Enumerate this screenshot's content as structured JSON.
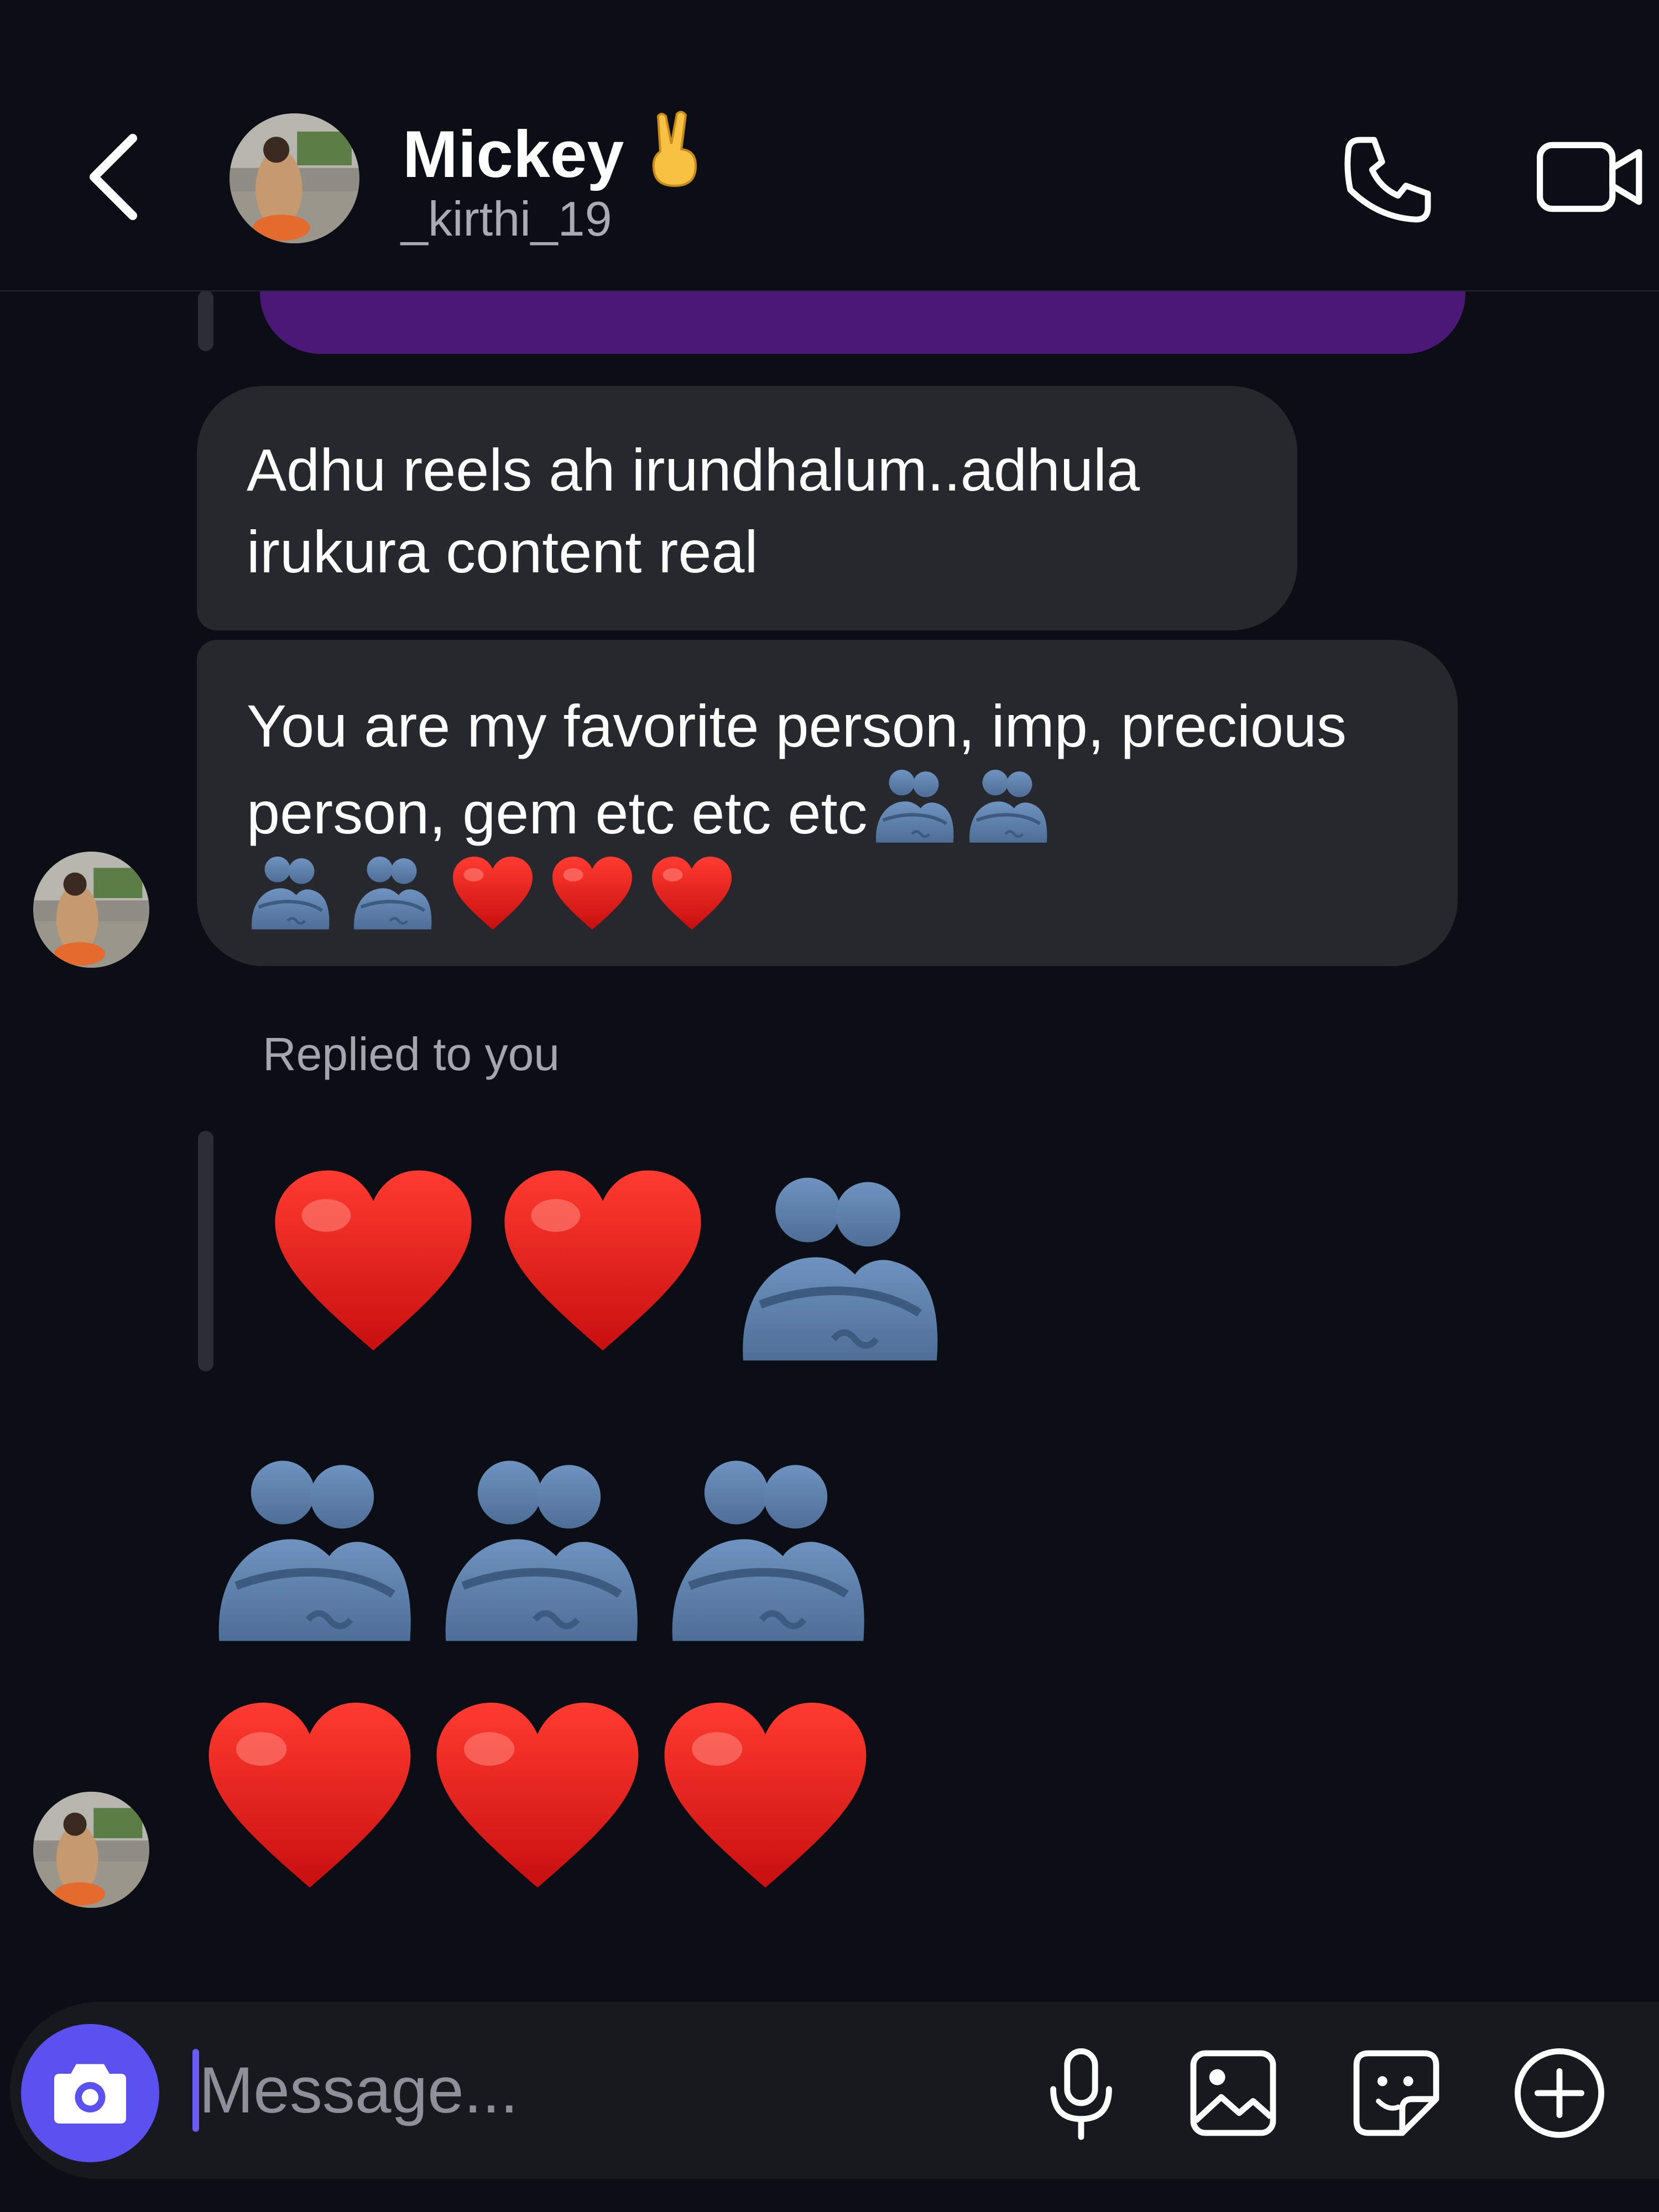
{
  "header": {
    "name": "Mickey",
    "name_emoji": "victory-hand-emoji",
    "username": "_kirthi_19",
    "icons": [
      "back-icon",
      "phone-icon",
      "video-camera-icon"
    ]
  },
  "messages": [
    {
      "text": "Adhu reels ah irundhalum..adhula irukura content real"
    },
    {
      "text": "You are my favorite person, imp, precious person, gem etc etc etc",
      "emojis": [
        "hug",
        "hug",
        "hug",
        "hug",
        "heart",
        "heart",
        "heart"
      ]
    }
  ],
  "reply": {
    "label": "Replied to you",
    "quoted_emojis": [
      "heart",
      "heart",
      "hug"
    ],
    "line1_emojis": [
      "hug",
      "hug",
      "hug"
    ],
    "line2_emojis": [
      "heart",
      "heart",
      "heart"
    ]
  },
  "composer": {
    "placeholder": "Message...",
    "icons": [
      "camera-icon",
      "microphone-icon",
      "image-icon",
      "sticker-icon",
      "plus-icon"
    ]
  },
  "colors": {
    "background": "#0b0e14",
    "bubble": "#26282e",
    "sent_bubble": "#4c1878",
    "camera_button": "#5b50f0"
  }
}
